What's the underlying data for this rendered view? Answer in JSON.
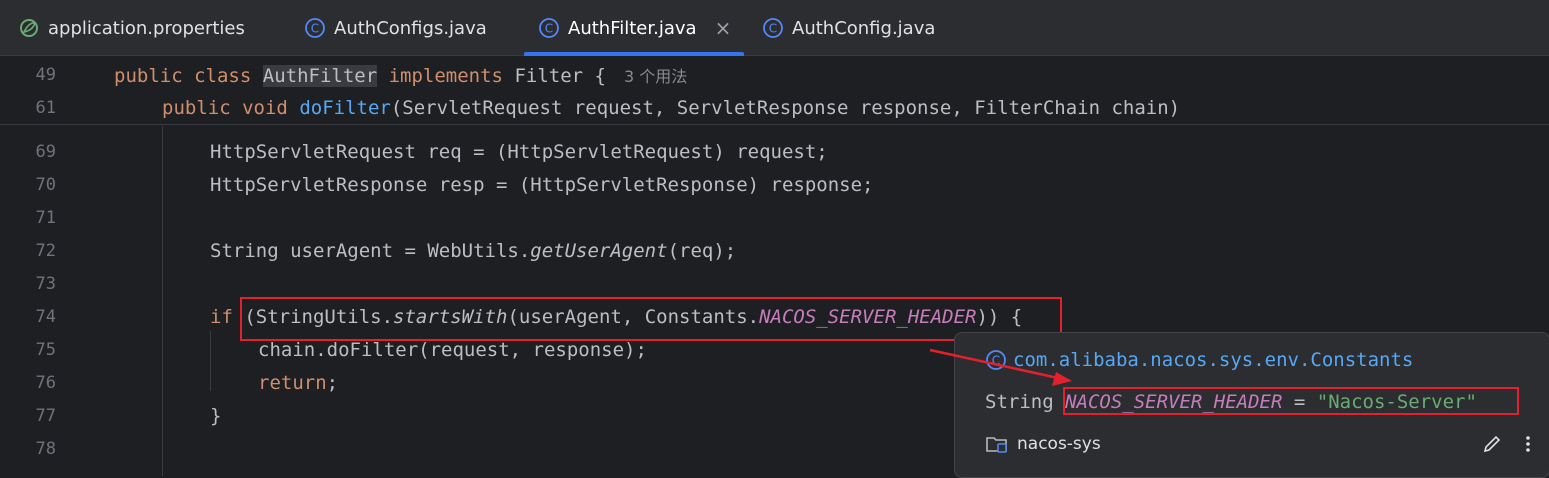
{
  "tabs": [
    {
      "label": "application.properties",
      "icon": "spring-leaf-icon"
    },
    {
      "label": "AuthConfigs.java",
      "icon": "class-icon"
    },
    {
      "label": "AuthFilter.java",
      "icon": "class-icon",
      "active": true
    },
    {
      "label": "AuthConfig.java",
      "icon": "class-icon"
    }
  ],
  "sticky": [
    {
      "ln": "49",
      "kw1": "public",
      "kw2": "class",
      "cls": "AuthFilter",
      "kw3": "implements",
      "iface": "Filter {",
      "hint": "3 个用法"
    },
    {
      "ln": "61",
      "kw1": "public",
      "kw2": "void",
      "method": "doFilter",
      "params": "(ServletRequest request, ServletResponse response, FilterChain chain)"
    }
  ],
  "lines": {
    "l69": {
      "ln": "69",
      "text": "HttpServletRequest req = (HttpServletRequest) request;"
    },
    "l70": {
      "ln": "70",
      "text": "HttpServletResponse resp = (HttpServletResponse) response;"
    },
    "l71": {
      "ln": "71"
    },
    "l72": {
      "ln": "72",
      "pre": "String userAgent = WebUtils.",
      "call": "getUserAgent",
      "post": "(req);"
    },
    "l73": {
      "ln": "73"
    },
    "l74": {
      "ln": "74",
      "kw": "if",
      "pre": " (StringUtils.",
      "call": "startsWith",
      "mid": "(userAgent, Constants.",
      "const": "NACOS_SERVER_HEADER",
      "post": ")) {"
    },
    "l75": {
      "ln": "75",
      "text": "chain.doFilter(request, response);"
    },
    "l76": {
      "ln": "76",
      "kw": "return",
      "post": ";"
    },
    "l77": {
      "ln": "77",
      "text": "}"
    },
    "l78": {
      "ln": "78"
    }
  },
  "popup": {
    "package": "com.alibaba.nacos.sys.env.Constants",
    "decl_type": "String",
    "decl_const": "NACOS_SERVER_HEADER",
    "decl_eq": " = ",
    "decl_value": "\"Nacos-Server\"",
    "module": "nacos-sys"
  },
  "colors": {
    "annotation_red": "#e5202d",
    "accent": "#3574f0"
  }
}
